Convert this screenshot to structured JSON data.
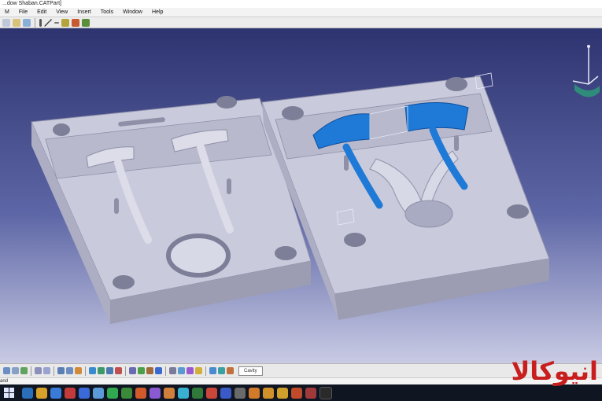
{
  "window": {
    "title": "...dow Shaban.CATPart]"
  },
  "menu": [
    {
      "label": "M"
    },
    {
      "label": "File"
    },
    {
      "label": "Edit"
    },
    {
      "label": "View"
    },
    {
      "label": "Insert"
    },
    {
      "label": "Tools"
    },
    {
      "label": "Window"
    },
    {
      "label": "Help"
    }
  ],
  "toolbar": {
    "cavity_label": "Cavity"
  },
  "status": {
    "text": "and"
  },
  "watermark": {
    "text": "انيوكالا"
  },
  "colors": {
    "mold_gray": "#c9cadb",
    "mold_shadow": "#9c9db3",
    "cavity_blue": "#1f79d6",
    "viewport_top": "#2e3470",
    "taskbar": "#101522",
    "watermark_red": "#c81e1e"
  },
  "icons": {
    "compass": "compass-icon",
    "windows": "windows-start-icon"
  }
}
